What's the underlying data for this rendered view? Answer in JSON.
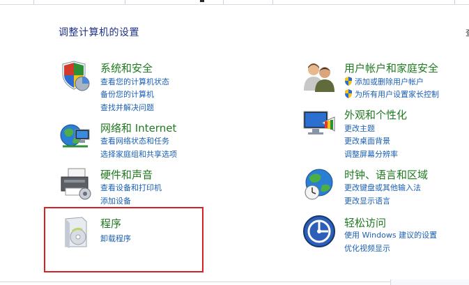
{
  "page": {
    "title": "调整计算机的设置",
    "right_cut": "查"
  },
  "left": [
    {
      "title": "系统和安全",
      "icon": "shield-pie-icon",
      "links": [
        "查看您的计算机状态",
        "备份您的计算机",
        "查找并解决问题"
      ]
    },
    {
      "title": "网络和 Internet",
      "icon": "globe-network-icon",
      "links": [
        "查看网络状态和任务",
        "选择家庭组和共享选项"
      ]
    },
    {
      "title": "硬件和声音",
      "icon": "printer-speaker-icon",
      "links": [
        "查看设备和打印机",
        "添加设备"
      ]
    },
    {
      "title": "程序",
      "icon": "program-box-icon",
      "links": [
        "卸载程序"
      ]
    }
  ],
  "right": [
    {
      "title": "用户帐户和家庭安全",
      "icon": "users-icon",
      "links": [
        "添加或删除用户帐户",
        "为所有用户设置家长控制"
      ]
    },
    {
      "title": "外观和个性化",
      "icon": "monitor-palette-icon",
      "links": [
        "更改主题",
        "更改桌面背景",
        "调整屏幕分辨率"
      ]
    },
    {
      "title": "时钟、语言和区域",
      "icon": "globe-clock-icon",
      "links": [
        "更改键盘或其他输入法",
        "更改显示语言"
      ]
    },
    {
      "title": "轻松访问",
      "icon": "ease-of-access-icon",
      "links": [
        "使用 Windows 建议的设置",
        "优化视频显示"
      ]
    }
  ],
  "colors": {
    "title_green": "#1f7a1f",
    "link_blue": "#1a5fb4",
    "heading_blue": "#1e3287",
    "annotation_red": "#d81f26"
  }
}
